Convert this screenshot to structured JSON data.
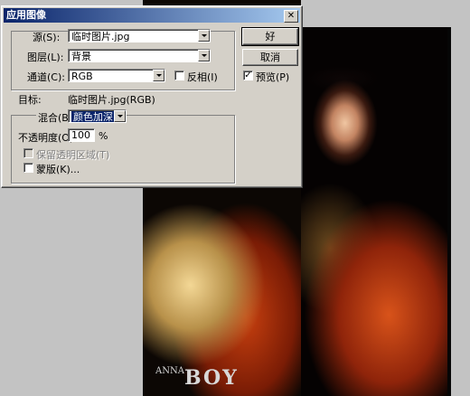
{
  "dialog": {
    "title": "应用图像",
    "close_glyph": "✕",
    "source": {
      "label": "源(S):",
      "value": "临时图片.jpg"
    },
    "layer": {
      "label": "图层(L):",
      "value": "背景"
    },
    "channel": {
      "label": "通道(C):",
      "value": "RGB"
    },
    "invert": {
      "label": "反相(I)",
      "checked": false
    },
    "target": {
      "label": "目标:",
      "value": "临时图片.jpg(RGB)"
    },
    "blending": {
      "label": "混合(B):",
      "value": "颜色加深"
    },
    "opacity": {
      "label": "不透明度(O):",
      "value": "100",
      "unit": "%"
    },
    "preserve_transparency": {
      "label": "保留透明区域(T)",
      "checked": false,
      "enabled": false
    },
    "mask": {
      "label": "蒙版(K)...",
      "checked": false
    },
    "buttons": {
      "ok": "好",
      "cancel": "取消"
    },
    "preview": {
      "label": "预览(P)",
      "checked": true,
      "check_glyph": "✓"
    }
  },
  "document": {
    "watermark_small": "ANNA",
    "watermark": "BOY"
  }
}
